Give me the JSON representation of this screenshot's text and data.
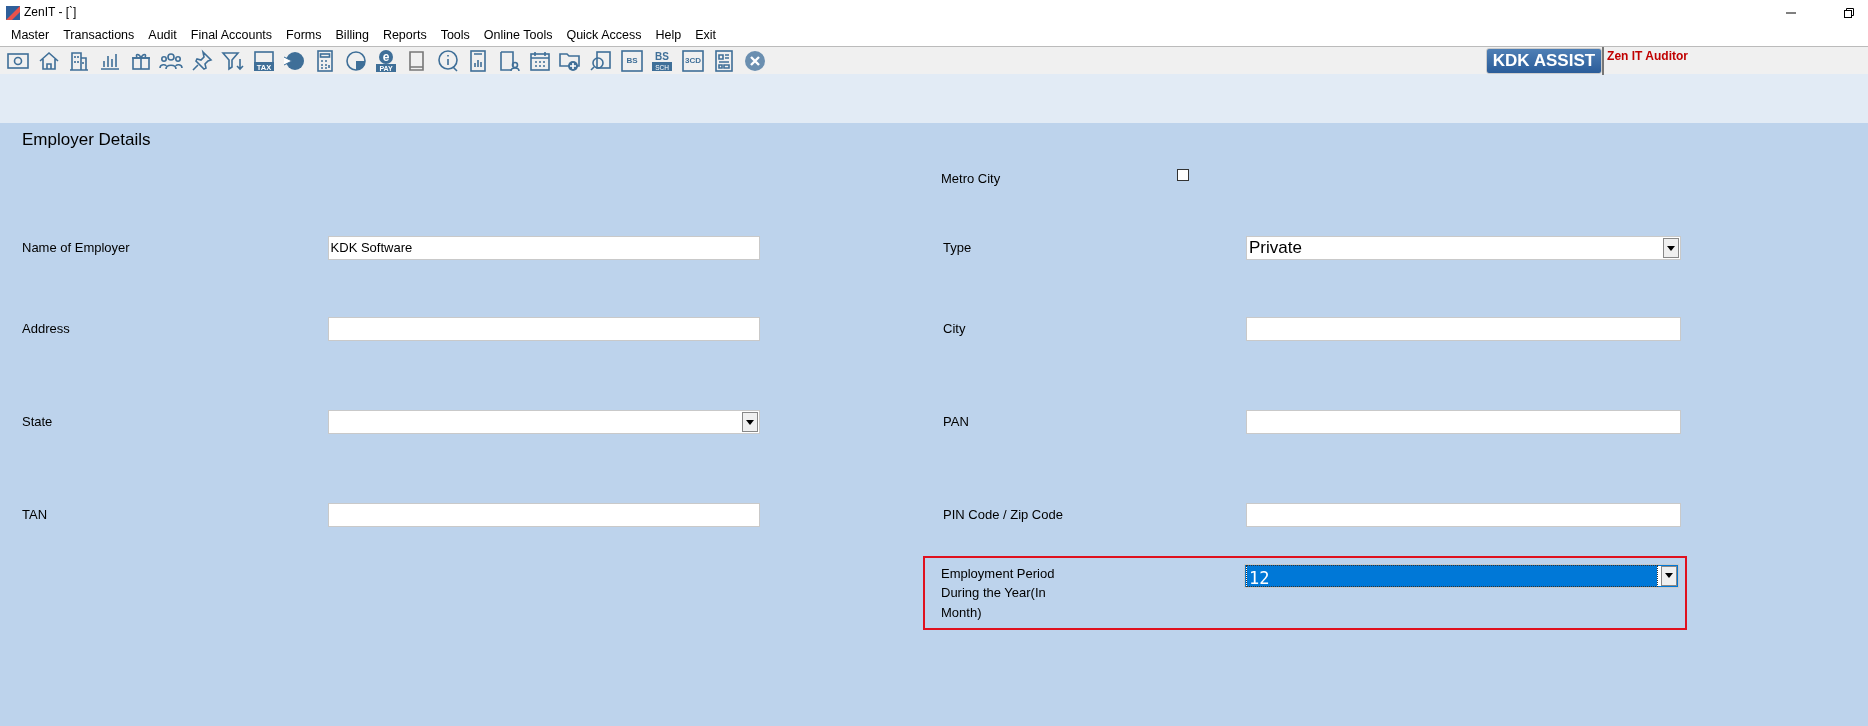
{
  "window": {
    "title": "ZenIT - [`]"
  },
  "menu": [
    "Master",
    "Transactions",
    "Audit",
    "Final Accounts",
    "Forms",
    "Billing",
    "Reports",
    "Tools",
    "Online Tools",
    "Quick Access",
    "Help",
    "Exit"
  ],
  "toolbar": [
    {
      "kind": "banknote"
    },
    {
      "kind": "house"
    },
    {
      "kind": "building"
    },
    {
      "kind": "bars"
    },
    {
      "kind": "gift"
    },
    {
      "kind": "people"
    },
    {
      "kind": "pin"
    },
    {
      "kind": "filter"
    },
    {
      "kind": "label",
      "labels": [
        "TAX"
      ]
    },
    {
      "kind": "arrow-circle"
    },
    {
      "kind": "calculator"
    },
    {
      "kind": "pie"
    },
    {
      "kind": "epay",
      "labels": [
        "e",
        "PAY"
      ]
    },
    {
      "kind": "book"
    },
    {
      "kind": "info"
    },
    {
      "kind": "report"
    },
    {
      "kind": "user-doc"
    },
    {
      "kind": "calendar"
    },
    {
      "kind": "folder-plus"
    },
    {
      "kind": "search-doc"
    },
    {
      "kind": "framed",
      "labels": [
        "BS"
      ]
    },
    {
      "kind": "stacked",
      "labels": [
        "BS",
        "SCH"
      ]
    },
    {
      "kind": "framed",
      "labels": [
        "3CD"
      ]
    },
    {
      "kind": "doc-grid"
    },
    {
      "kind": "close-circle"
    }
  ],
  "assist_button": "KDK ASSIST",
  "product": "Zen IT Auditor",
  "form": {
    "title": "Employer Details",
    "metro_city": {
      "label": "Metro City",
      "checked": false
    },
    "rows": [
      {
        "left": {
          "label": "Name of Employer",
          "kind": "text",
          "value": "KDK Software",
          "highlighted": false,
          "selected": false
        },
        "right": {
          "label": "Type",
          "kind": "dropdown",
          "value": "Private",
          "highlighted": false,
          "selected": false
        }
      },
      {
        "left": {
          "label": "Address",
          "kind": "text",
          "highlighted": false,
          "selected": false
        },
        "right": {
          "label": "City",
          "kind": "text",
          "highlighted": false,
          "selected": false
        }
      },
      {
        "left": {
          "label": "State",
          "kind": "dropdown",
          "highlighted": false,
          "selected": false
        },
        "right": {
          "label": "PAN",
          "kind": "text",
          "highlighted": false,
          "selected": false
        }
      },
      {
        "left": {
          "label": "TAN",
          "kind": "text",
          "highlighted": false,
          "selected": false
        },
        "right": {
          "label": "PIN Code / Zip Code",
          "kind": "text",
          "highlighted": false,
          "selected": false
        }
      },
      {
        "right": {
          "label": "Employment Period During the Year(In Month)",
          "kind": "dropdown",
          "value": "12",
          "highlighted": true,
          "selected": true
        }
      }
    ]
  }
}
